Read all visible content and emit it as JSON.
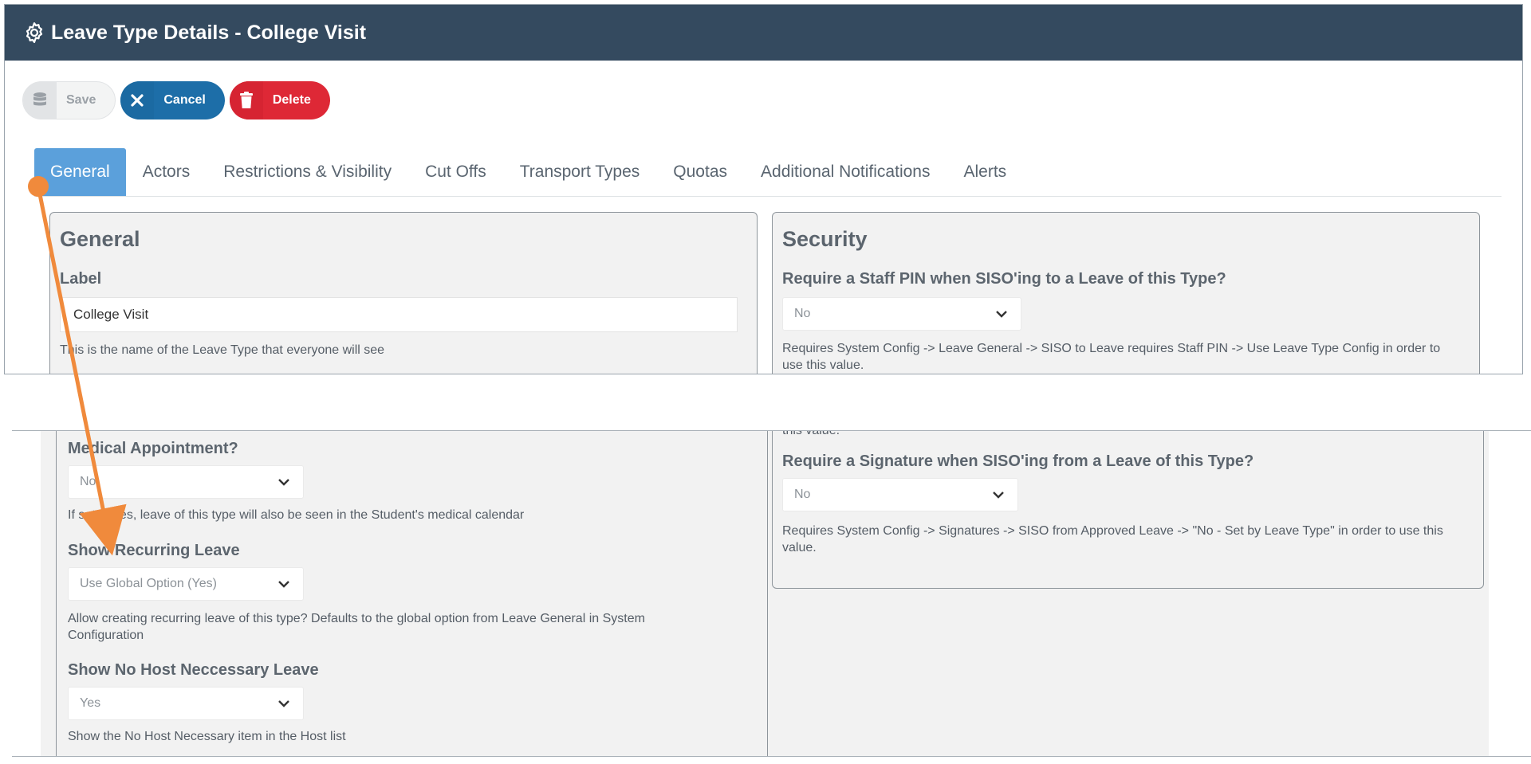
{
  "header": {
    "title": "Leave Type Details - College Visit",
    "icon": "gear-icon"
  },
  "toolbar": {
    "save_label": "Save",
    "cancel_label": "Cancel",
    "delete_label": "Delete"
  },
  "tabs": [
    "General",
    "Actors",
    "Restrictions & Visibility",
    "Cut Offs",
    "Transport Types",
    "Quotas",
    "Additional Notifications",
    "Alerts"
  ],
  "general": {
    "heading": "General",
    "label_field": {
      "label": "Label",
      "value": "College Visit",
      "help": "This is the name of the Leave Type that everyone will see"
    },
    "medical": {
      "label": "Medical Appointment?",
      "value": "No",
      "help": "If set to yes, leave of this type will also be seen in the Student's medical calendar"
    },
    "recurring": {
      "label": "Show Recurring Leave",
      "value": "Use Global Option (Yes)",
      "help": "Allow creating recurring leave of this type? Defaults to the global option from Leave General in System Configuration"
    },
    "nohost": {
      "label": "Show No Host Neccessary Leave",
      "value": "Yes",
      "help": "Show the No Host Necessary item in the Host list"
    }
  },
  "security": {
    "heading": "Security",
    "staff_pin": {
      "label": "Require a Staff PIN when SISO'ing to a Leave of this Type?",
      "value": "No",
      "help": "Requires System Config -> Leave General -> SISO to Leave requires Staff PIN -> Use Leave Type Config in order to use this value."
    },
    "partial_help": "this value.",
    "signature": {
      "label": "Require a Signature when SISO'ing from a Leave of this Type?",
      "value": "No",
      "help": "Requires System Config -> Signatures -> SISO from Approved Leave -> \"No - Set by Leave Type\" in order to use this value."
    }
  },
  "colors": {
    "header_bg": "#344a5f",
    "tab_active": "#5ba0db",
    "cancel": "#1d6ea8",
    "delete": "#de2836",
    "annotation": "#f08a3c"
  }
}
